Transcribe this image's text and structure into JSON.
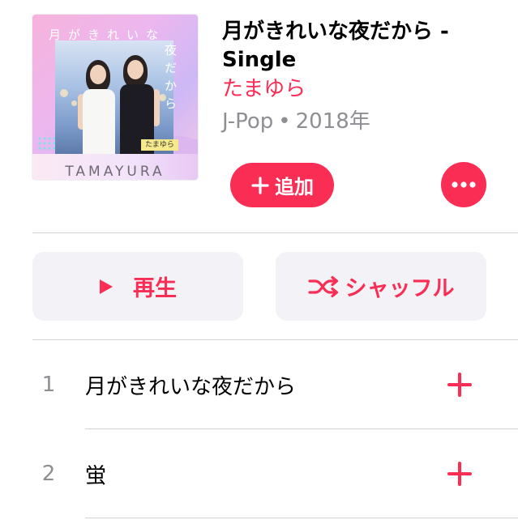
{
  "album": {
    "cover": {
      "title_top": "月がきれいな",
      "title_side": "夜だから",
      "artist_label": "たまゆら",
      "brand": "TAMAYURA"
    },
    "title": "月がきれいな夜だから - Single",
    "artist": "たまゆら",
    "genre": "J-Pop",
    "separator": "•",
    "year": "2018年"
  },
  "actions": {
    "add_label": "追加",
    "add_icon": "plus-icon",
    "more_icon": "ellipsis-icon"
  },
  "controls": {
    "play_label": "再生",
    "play_icon": "play-icon",
    "shuffle_label": "シャッフル",
    "shuffle_icon": "shuffle-icon"
  },
  "tracks": [
    {
      "number": "1",
      "title": "月がきれいな夜だから",
      "action_icon": "plus-icon"
    },
    {
      "number": "2",
      "title": "蛍",
      "action_icon": "plus-icon"
    }
  ],
  "colors": {
    "accent": "#FA2D55",
    "text": "#000000",
    "secondary": "#8E8E93",
    "button_background": "#F2F2F7",
    "divider": "#D1D1D6",
    "background": "#FFFFFF"
  }
}
